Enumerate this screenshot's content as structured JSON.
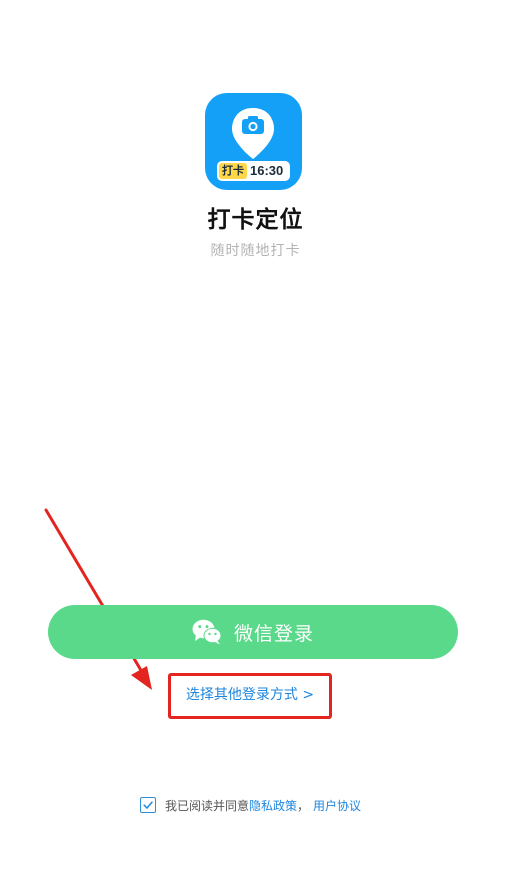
{
  "app": {
    "name": "打卡定位",
    "tagline": "随时随地打卡",
    "icon_badge_tag": "打卡",
    "icon_badge_time": "16:30",
    "icon_color": "#14a0f7",
    "badge_tag_color": "#ffd84a"
  },
  "login": {
    "wechat_label": "微信登录",
    "wechat_icon": "wechat-icon",
    "wechat_button_color": "#5bd98a",
    "other_label": "选择其他登录方式 >",
    "highlight_color": "#e4241f"
  },
  "agreement": {
    "checked": true,
    "prefix": "我已阅读并同意",
    "privacy_label": "隐私政策",
    "separator": "，",
    "terms_label": "用户协议",
    "link_color": "#1f86de"
  }
}
